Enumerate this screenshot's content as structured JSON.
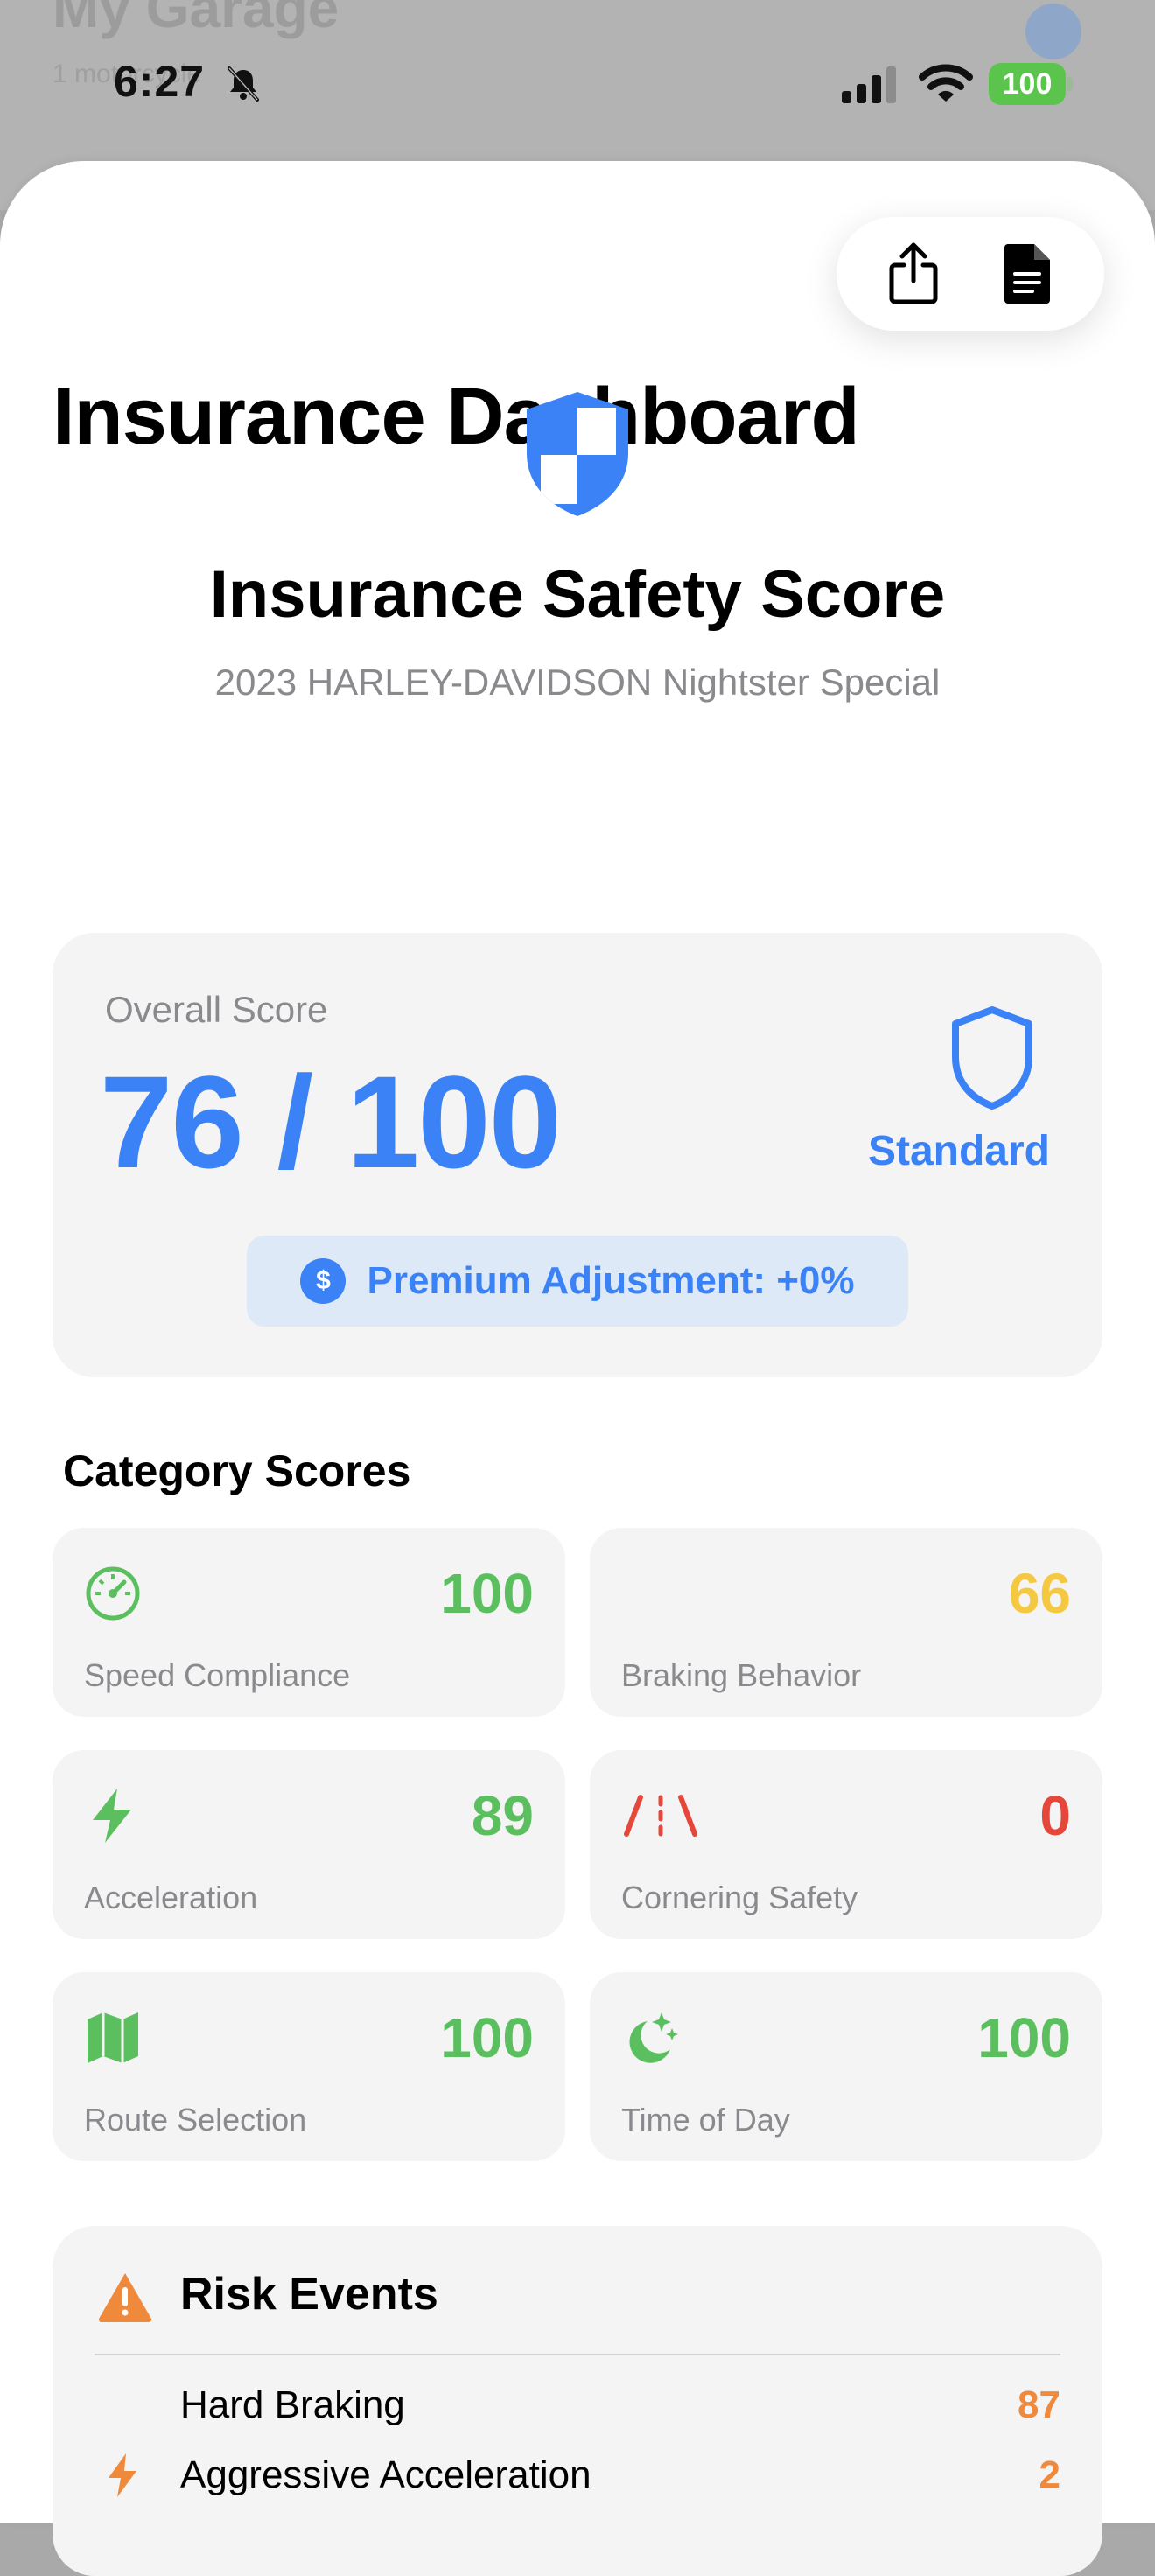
{
  "backdrop": {
    "title": "My Garage",
    "subtitle": "1 motorcycle"
  },
  "status_bar": {
    "time": "6:27",
    "battery": "100"
  },
  "header": {
    "title": "Insurance Dashboard"
  },
  "toolbar": {
    "share_icon": "share-icon",
    "report_icon": "document-icon"
  },
  "hero": {
    "title": "Insurance Safety Score",
    "vehicle": "2023 HARLEY-DAVIDSON Nightster Special"
  },
  "overall": {
    "label": "Overall Score",
    "score": "76 / 100",
    "tier": "Standard",
    "premium": "Premium Adjustment: +0%"
  },
  "categories": {
    "title": "Category Scores",
    "items": [
      {
        "label": "Speed Compliance",
        "score": "100",
        "color": "#5cbf5f",
        "icon": "speedometer-icon"
      },
      {
        "label": "Braking Behavior",
        "score": "66",
        "color": "#f5c842",
        "icon": ""
      },
      {
        "label": "Acceleration",
        "score": "89",
        "color": "#5cbf5f",
        "icon": "bolt-icon"
      },
      {
        "label": "Cornering Safety",
        "score": "0",
        "color": "#e5483b",
        "icon": "road-icon"
      },
      {
        "label": "Route Selection",
        "score": "100",
        "color": "#5cbf5f",
        "icon": "map-icon"
      },
      {
        "label": "Time of Day",
        "score": "100",
        "color": "#5cbf5f",
        "icon": "moon-stars-icon"
      }
    ]
  },
  "risk_events": {
    "title": "Risk Events",
    "items": [
      {
        "label": "Hard Braking",
        "count": "87"
      },
      {
        "label": "Aggressive Acceleration",
        "count": "2"
      }
    ]
  },
  "colors": {
    "accent": "#3b82f6",
    "warning": "#ef8a3c",
    "good": "#5cbf5f",
    "bad": "#e5483b",
    "caution": "#f5c842"
  }
}
